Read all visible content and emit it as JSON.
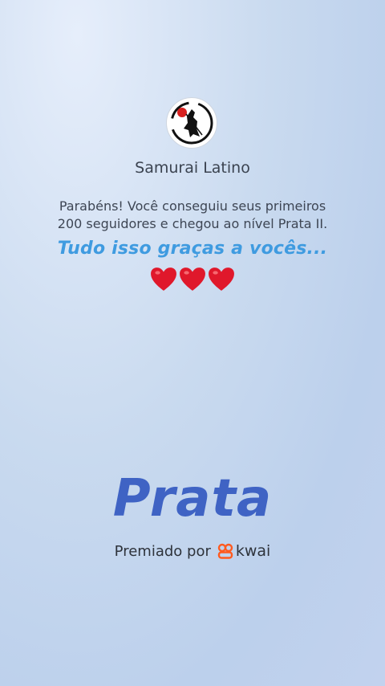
{
  "profile": {
    "name": "Samurai Latino"
  },
  "message": {
    "line1": "Parabéns! Você conseguiu seus primeiros",
    "line2": "200 seguidores e chegou ao nível Prata II."
  },
  "overlay_text": "Tudo isso graças a vocês...",
  "hearts": {
    "count": 3,
    "icon": "heart-icon",
    "color": "#e0182b"
  },
  "level": {
    "name": "Prata",
    "color": "#3f63c4"
  },
  "footer": {
    "awarded_by": "Premiado por",
    "brand": "kwai",
    "brand_color": "#ff5a1f"
  },
  "colors": {
    "handwritten_text": "#3f9be0"
  }
}
